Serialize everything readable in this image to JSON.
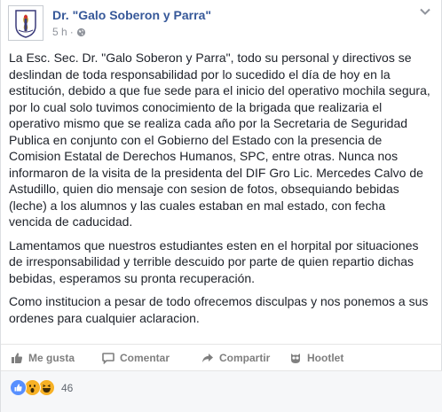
{
  "post": {
    "page_name": "Dr. \"Galo Soberon y Parra\"",
    "timestamp": "5 h",
    "separator": "·",
    "audience_icon": "globe-icon",
    "menu_icon": "chevron-down-icon",
    "paragraphs": [
      "La Esc. Sec. Dr. \"Galo Soberon y Parra\", todo su personal y directivos se deslindan de toda responsabilidad por lo sucedido el día de hoy en la estitución, debido a que fue sede para el inicio del operativo mochila segura, por lo cual solo tuvimos conocimiento de la brigada que realizaria el operativo mismo que se realiza cada año por la Secretaria de Seguridad Publica en conjunto con el Gobierno del Estado con la presencia de Comision Estatal de Derechos Humanos, SPC, entre otras. Nunca nos informaron de la visita de la presidenta del DIF Gro Lic. Mercedes Calvo de Astudillo, quien dio mensaje con sesion de fotos, obsequiando bebidas (leche) a los alumnos y las cuales estaban en mal estado, con fecha vencida de caducidad.",
      "Lamentamos que nuestros estudiantes esten en el horpital por situaciones de irresponsabilidad y terrible descuido por parte de quien repartio dichas bebidas, esperamos su pronta recuperación.",
      "Como institucion a pesar de todo ofrecemos disculpas y nos ponemos a sus ordenes para cualquier aclaracion."
    ]
  },
  "actions": {
    "like_label": "Me gusta",
    "comment_label": "Comentar",
    "share_label": "Compartir",
    "hootlet_label": "Hootlet"
  },
  "reactions": {
    "types": [
      "like",
      "wow",
      "haha"
    ],
    "count": "46"
  },
  "colors": {
    "link": "#365899",
    "like_blue": "#5890ff",
    "emoji_yellow": "#f7b125"
  }
}
